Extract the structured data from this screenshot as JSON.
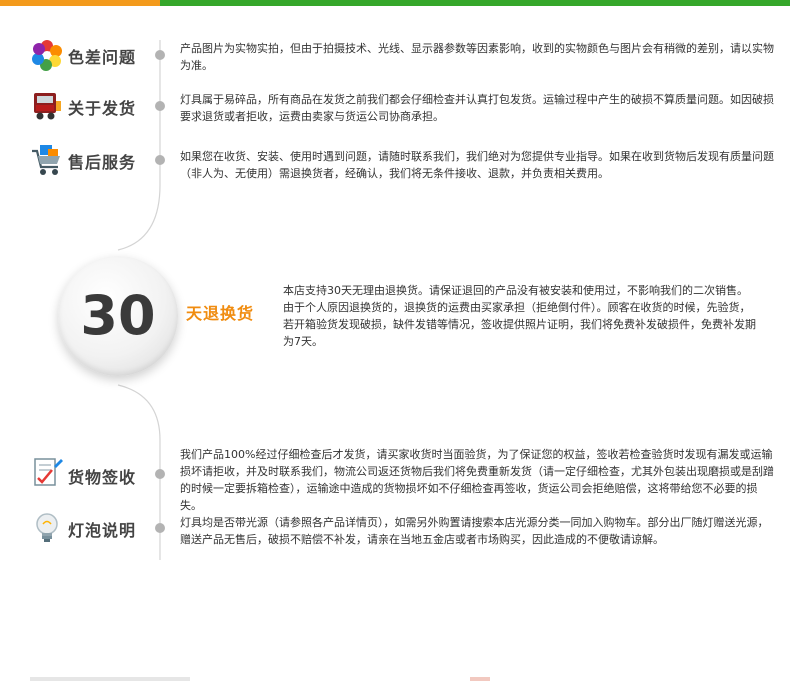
{
  "colors": {
    "orange": "#f39a1c",
    "green": "#35a72a",
    "title_gray": "#444444",
    "accent_orange": "#f08c10"
  },
  "sections": [
    {
      "icon": "color-palette-icon",
      "title": "色差问题",
      "desc": "产品图片为实物实拍，但由于拍摄技术、光线、显示器参数等因素影响，收到的实物颜色与图片会有稍微的差别，请以实物为准。"
    },
    {
      "icon": "delivery-truck-icon",
      "title": "关于发货",
      "desc": "灯具属于易碎品，所有商品在发货之前我们都会仔细检查并认真打包发货。运输过程中产生的破损不算质量问题。如因破损要求退货或者拒收，运费由卖家与货运公司协商承担。"
    },
    {
      "icon": "shopping-cart-icon",
      "title": "售后服务",
      "desc": "如果您在收货、安装、使用时遇到问题，请随时联系我们，我们绝对为您提供专业指导。如果在收到货物后发现有质量问题（非人为、无使用）需退换货者，经确认，我们将无条件接收、退款，并负责相关费用。"
    }
  ],
  "return_policy": {
    "number": "30",
    "title": "天退换货",
    "desc": "本店支持30天无理由退换货。请保证退回的产品没有被安装和使用过，不影响我们的二次销售。由于个人原因退换货的，退换货的运费由买家承担（拒绝倒付件）。顾客在收货的时候，先验货，若开箱验货发现破损，缺件发错等情况，签收提供照片证明，我们将免费补发破损件，免费补发期为7天。"
  },
  "sections_bottom": [
    {
      "icon": "sign-document-icon",
      "title": "货物签收",
      "desc": "我们产品100%经过仔细检查后才发货，请买家收货时当面验货，为了保证您的权益，签收若检查验货时发现有漏发或运输损坏请拒收，并及时联系我们，物流公司返还货物后我们将免费重新发货（请一定仔细检查，尤其外包装出现磨损或是刮蹭的时候一定要拆箱检查），运输途中造成的货物损坏如不仔细检查再签收，货运公司会拒绝赔偿，这将带给您不必要的损失。"
    },
    {
      "icon": "light-bulb-icon",
      "title": "灯泡说明",
      "desc": "灯具均是否带光源（请参照各产品详情页），如需另外购置请搜索本店光源分类一同加入购物车。部分出厂随灯赠送光源，赠送产品无售后，破损不赔偿不补发，请亲在当地五金店或者市场购买，因此造成的不便敬请谅解。"
    }
  ]
}
